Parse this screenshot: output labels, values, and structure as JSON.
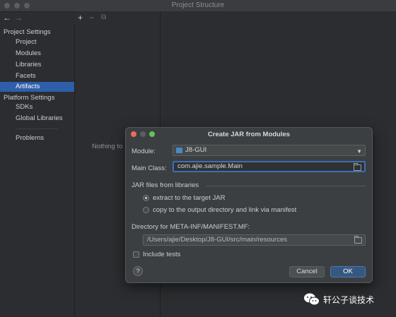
{
  "window": {
    "title": "Project Structure"
  },
  "nav": {
    "back": "←",
    "forward": "→"
  },
  "sidebar": {
    "project_settings_header": "Project Settings",
    "project_items": [
      {
        "label": "Project"
      },
      {
        "label": "Modules"
      },
      {
        "label": "Libraries"
      },
      {
        "label": "Facets"
      },
      {
        "label": "Artifacts",
        "active": true
      }
    ],
    "platform_settings_header": "Platform Settings",
    "platform_items": [
      {
        "label": "SDKs"
      },
      {
        "label": "Global Libraries"
      }
    ],
    "problems": "Problems"
  },
  "toolbar": {
    "add": "+",
    "remove": "−",
    "copy": "⧉"
  },
  "artifacts_panel": {
    "empty_text": "Nothing to"
  },
  "dialog": {
    "title": "Create JAR from Modules",
    "module_label": "Module:",
    "module_value": "J8-GUI",
    "main_class_label": "Main Class:",
    "main_class_value": "com.ajie.sample.Main",
    "jar_section_label": "JAR files from libraries",
    "radio_extract": "extract to the target JAR",
    "radio_copy": "copy to the output directory and link via manifest",
    "manifest_label": "Directory for META-INF/MANIFEST.MF:",
    "manifest_value": "/Users/ajie/Desktop/J8-GUI/src/main/resources",
    "include_tests": "Include tests",
    "help": "?",
    "cancel": "Cancel",
    "ok": "OK"
  },
  "watermark": {
    "text": "轩公子谈技术"
  },
  "colors": {
    "accent": "#2f5eab",
    "ok_button": "#365880",
    "close": "#ec6a5e",
    "minimize": "#f4bf4f",
    "zoom": "#61c554"
  }
}
